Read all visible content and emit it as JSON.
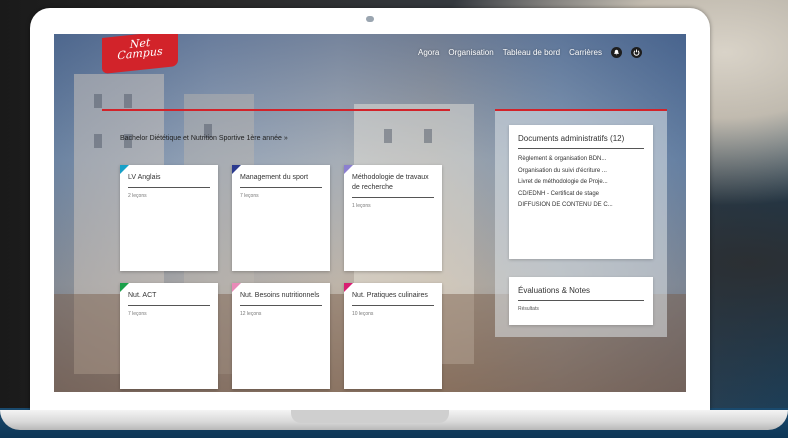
{
  "brand": {
    "logo_line1": "Net",
    "logo_line2": "Campus",
    "accent": "#d2232a"
  },
  "nav": {
    "links": [
      "Agora",
      "Organisation",
      "Tableau de bord",
      "Carrières"
    ],
    "icons": [
      "bell-icon",
      "power-icon"
    ]
  },
  "program": {
    "title": "Bachelor Diététique et Nutrition Sportive 1ère année »"
  },
  "courses": [
    {
      "title": "LV Anglais",
      "count": "2 leçons",
      "color": "#18a0c8"
    },
    {
      "title": "Management du sport",
      "count": "7 leçons",
      "color": "#2b3a8f"
    },
    {
      "title": "Méthodologie de travaux de recherche",
      "count": "1 leçons",
      "color": "#8b7fd0"
    },
    {
      "title": "Nut. ACT",
      "count": "7 leçons",
      "color": "#1aa04a"
    },
    {
      "title": "Nut. Besoins nutritionnels",
      "count": "12 leçons",
      "color": "#e88ab8"
    },
    {
      "title": "Nut. Pratiques culinaires",
      "count": "10 leçons",
      "color": "#d81e72"
    }
  ],
  "documents": {
    "title": "Documents administratifs (12)",
    "items": [
      "Règlement & organisation BDN...",
      "Organisation du suivi d'écriture ...",
      "Livret de méthodologie de Proje...",
      "CD/EDNH - Certificat de stage",
      "DIFFUSION DE CONTENU DE C..."
    ]
  },
  "evaluations": {
    "title": "Évaluations & Notes",
    "subtitle": "Résultats"
  }
}
